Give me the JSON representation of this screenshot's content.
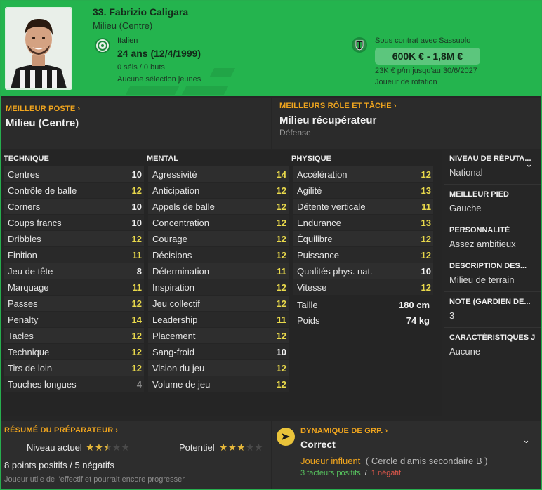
{
  "player": {
    "name": "33. Fabrizio Caligara",
    "position": "Milieu (Centre)",
    "nationality": "Italien",
    "age": "24 ans (12/4/1999)",
    "caps": "0 séls / 0 buts",
    "youth_caps": "Aucune sélection jeunes",
    "contract": "Sous contrat avec Sassuolo",
    "value": "600K € - 1,8M €",
    "wage": "23K € p/m jusqu'au 30/6/2027",
    "squad_role": "Joueur de rotation"
  },
  "best_position": {
    "label": "MEILLEUR POSTE",
    "value": "Milieu (Centre)"
  },
  "best_role": {
    "label": "MEILLEURS RÔLE ET TÂCHE",
    "value": "Milieu récupérateur",
    "duty": "Défense"
  },
  "technique": {
    "title": "TECHNIQUE",
    "rows": [
      {
        "name": "Centres",
        "value": "10",
        "tier": "white"
      },
      {
        "name": "Contrôle de balle",
        "value": "12",
        "tier": "yellow"
      },
      {
        "name": "Corners",
        "value": "10",
        "tier": "white"
      },
      {
        "name": "Coups francs",
        "value": "10",
        "tier": "white"
      },
      {
        "name": "Dribbles",
        "value": "12",
        "tier": "yellow"
      },
      {
        "name": "Finition",
        "value": "11",
        "tier": "yellow"
      },
      {
        "name": "Jeu de tête",
        "value": "8",
        "tier": "white"
      },
      {
        "name": "Marquage",
        "value": "11",
        "tier": "yellow"
      },
      {
        "name": "Passes",
        "value": "12",
        "tier": "yellow"
      },
      {
        "name": "Penalty",
        "value": "14",
        "tier": "yellow"
      },
      {
        "name": "Tacles",
        "value": "12",
        "tier": "yellow"
      },
      {
        "name": "Technique",
        "value": "12",
        "tier": "yellow"
      },
      {
        "name": "Tirs de loin",
        "value": "12",
        "tier": "yellow"
      },
      {
        "name": "Touches longues",
        "value": "4",
        "tier": "grey"
      }
    ]
  },
  "mental": {
    "title": "MENTAL",
    "rows": [
      {
        "name": "Agressivité",
        "value": "14",
        "tier": "yellow"
      },
      {
        "name": "Anticipation",
        "value": "12",
        "tier": "yellow"
      },
      {
        "name": "Appels de balle",
        "value": "12",
        "tier": "yellow"
      },
      {
        "name": "Concentration",
        "value": "12",
        "tier": "yellow"
      },
      {
        "name": "Courage",
        "value": "12",
        "tier": "yellow"
      },
      {
        "name": "Décisions",
        "value": "12",
        "tier": "yellow"
      },
      {
        "name": "Détermination",
        "value": "11",
        "tier": "yellow"
      },
      {
        "name": "Inspiration",
        "value": "12",
        "tier": "yellow"
      },
      {
        "name": "Jeu collectif",
        "value": "12",
        "tier": "yellow"
      },
      {
        "name": "Leadership",
        "value": "11",
        "tier": "yellow"
      },
      {
        "name": "Placement",
        "value": "12",
        "tier": "yellow"
      },
      {
        "name": "Sang-froid",
        "value": "10",
        "tier": "white"
      },
      {
        "name": "Vision du jeu",
        "value": "12",
        "tier": "yellow"
      },
      {
        "name": "Volume de jeu",
        "value": "12",
        "tier": "yellow"
      }
    ]
  },
  "physique": {
    "title": "PHYSIQUE",
    "rows": [
      {
        "name": "Accélération",
        "value": "12",
        "tier": "yellow"
      },
      {
        "name": "Agilité",
        "value": "13",
        "tier": "yellow"
      },
      {
        "name": "Détente verticale",
        "value": "11",
        "tier": "yellow"
      },
      {
        "name": "Endurance",
        "value": "13",
        "tier": "yellow"
      },
      {
        "name": "Équilibre",
        "value": "12",
        "tier": "yellow"
      },
      {
        "name": "Puissance",
        "value": "12",
        "tier": "yellow"
      },
      {
        "name": "Qualités phys. nat.",
        "value": "10",
        "tier": "white"
      },
      {
        "name": "Vitesse",
        "value": "12",
        "tier": "yellow"
      }
    ],
    "height_label": "Taille",
    "height": "180 cm",
    "weight_label": "Poids",
    "weight": "74 kg"
  },
  "info": {
    "reputation_label": "NIVEAU DE RÉPUTA...",
    "reputation": "National",
    "foot_label": "MEILLEUR PIED",
    "foot": "Gauche",
    "personality_label": "PERSONNALITÉ",
    "personality": "Assez ambitieux",
    "description_label": "DESCRIPTION DES...",
    "description": "Milieu de terrain",
    "gk_label": "NOTE (GARDIEN DE...",
    "gk": "3",
    "traits_label": "CARACTÉRISTIQUES J",
    "traits": "Aucune"
  },
  "coach": {
    "label": "RÉSUMÉ DU PRÉPARATEUR",
    "current_label": "Niveau actuel",
    "current_stars": 2.5,
    "potential_label": "Potentiel",
    "potential_stars": 3,
    "summary": "8 points positifs / 5 négatifs",
    "comment": "Joueur utile de l'effectif et pourrait encore progresser"
  },
  "dynamics": {
    "label": "DYNAMIQUE DE GRP.",
    "status": "Correct",
    "influence": "Joueur influent",
    "circle": "( Cercle d'amis secondaire B )",
    "positives": "3 facteurs positifs",
    "separator": "/",
    "negatives": "1 négatif"
  },
  "colors": {
    "header_green": "#24b44e",
    "accent_orange": "#f0a51e",
    "good_yellow": "#e9d94b",
    "star_gold": "#e6b83a"
  }
}
